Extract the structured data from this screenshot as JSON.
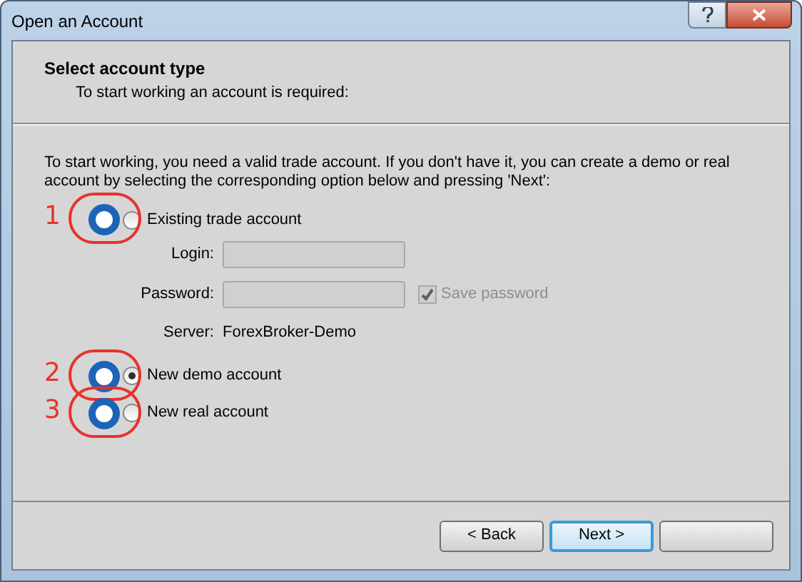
{
  "window": {
    "title": "Open an Account"
  },
  "header": {
    "title": "Select account type",
    "subtitle": "To start working an account is required:"
  },
  "intro": "To start working, you need a valid trade account. If you don't have it, you can create a demo or real account by selecting the corresponding option below and pressing 'Next':",
  "options": [
    {
      "label": "Existing trade account",
      "selected": false,
      "annotation": "1"
    },
    {
      "label": "New demo account",
      "selected": true,
      "annotation": "2"
    },
    {
      "label": "New real account",
      "selected": false,
      "annotation": "3"
    }
  ],
  "login": {
    "label": "Login:",
    "disabled": true
  },
  "password": {
    "label": "Password:",
    "disabled": true
  },
  "save_password": {
    "label": "Save password",
    "checked": true,
    "disabled": true
  },
  "server": {
    "label": "Server:",
    "value": "ForexBroker-Demo"
  },
  "buttons": [
    {
      "label": "< Back",
      "default": false
    },
    {
      "label": "Next >",
      "default": true
    }
  ]
}
